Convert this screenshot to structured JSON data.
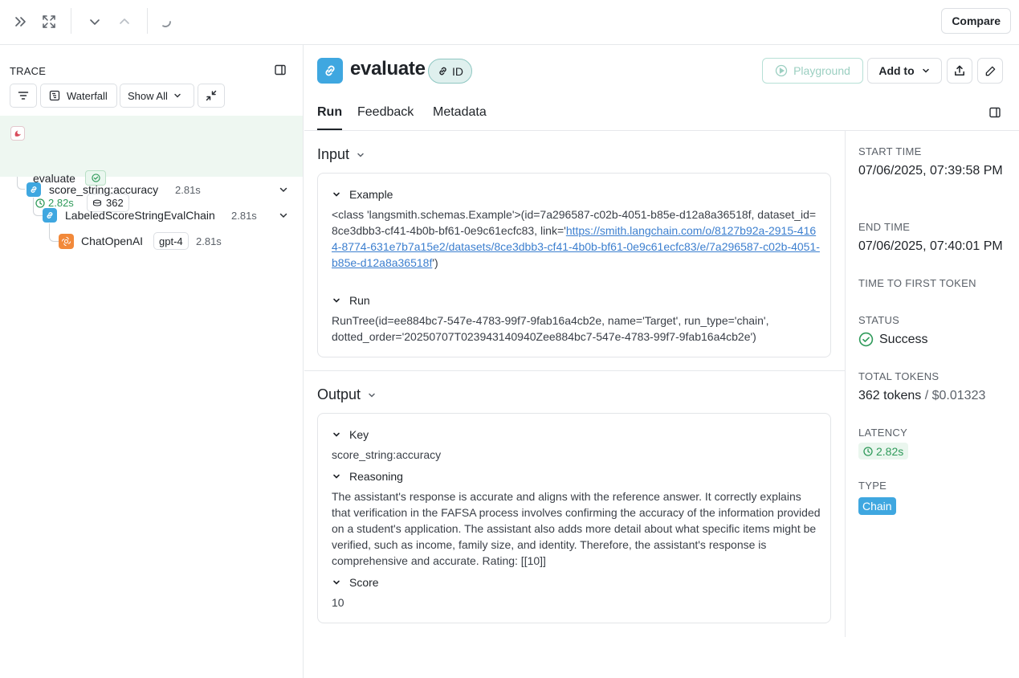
{
  "topbar": {
    "compare_label": "Compare"
  },
  "trace": {
    "title": "TRACE",
    "controls": {
      "waterfall": "Waterfall",
      "show_all": "Show All"
    },
    "tree": [
      {
        "label": "evaluate",
        "latency": "2.82s",
        "tokens": "362"
      },
      {
        "label": "score_string:accuracy",
        "latency": "2.81s"
      },
      {
        "label": "LabeledScoreStringEvalChain",
        "latency": "2.81s"
      },
      {
        "label": "ChatOpenAI",
        "model": "gpt-4",
        "latency": "2.81s"
      }
    ]
  },
  "header": {
    "title": "evaluate",
    "id_label": "ID",
    "playground_label": "Playground",
    "add_to_label": "Add to"
  },
  "tabs": [
    "Run",
    "Feedback",
    "Metadata"
  ],
  "input": {
    "title": "Input",
    "example_label": "Example",
    "example_prefix": "<class 'langsmith.schemas.Example'>(id=7a296587-c02b-4051-b85e-d12a8a36518f, dataset_id=8ce3dbb3-cf41-4b0b-bf61-0e9c61ecfc83, link='",
    "example_link": "https://smith.langchain.com/o/8127b92a-2915-4164-8774-631e7b7a15e2/datasets/8ce3dbb3-cf41-4b0b-bf61-0e9c61ecfc83/e/7a296587-c02b-4051-b85e-d12a8a36518f",
    "example_suffix": "')",
    "run_label": "Run",
    "run_text": "RunTree(id=ee884bc7-547e-4783-99f7-9fab16a4cb2e, name='Target', run_type='chain', dotted_order='20250707T023943140940Zee884bc7-547e-4783-99f7-9fab16a4cb2e')"
  },
  "output": {
    "title": "Output",
    "key_label": "Key",
    "key_value": "score_string:accuracy",
    "reasoning_label": "Reasoning",
    "reasoning_text": "The assistant's response is accurate and aligns with the reference answer. It correctly explains that verification in the FAFSA process involves confirming the accuracy of the information provided on a student's application. The assistant also adds more detail about what specific items might be verified, such as income, family size, and identity. Therefore, the assistant's response is comprehensive and accurate. Rating: [[10]]",
    "score_label": "Score",
    "score_value": "10"
  },
  "meta": {
    "start_time_label": "START TIME",
    "start_time": "07/06/2025, 07:39:58 PM",
    "end_time_label": "END TIME",
    "end_time": "07/06/2025, 07:40:01 PM",
    "ttft_label": "TIME TO FIRST TOKEN",
    "status_label": "STATUS",
    "status": "Success",
    "total_tokens_label": "TOTAL TOKENS",
    "total_tokens": "362 tokens",
    "cost": "/ $0.01323",
    "latency_label": "LATENCY",
    "latency": "2.82s",
    "type_label": "TYPE",
    "type": "Chain"
  },
  "colors": {
    "accent_blue": "#3fa7e0",
    "success_green": "#2f9a5a",
    "openai_orange": "#f2893a",
    "link_blue": "#3c7fcf"
  }
}
